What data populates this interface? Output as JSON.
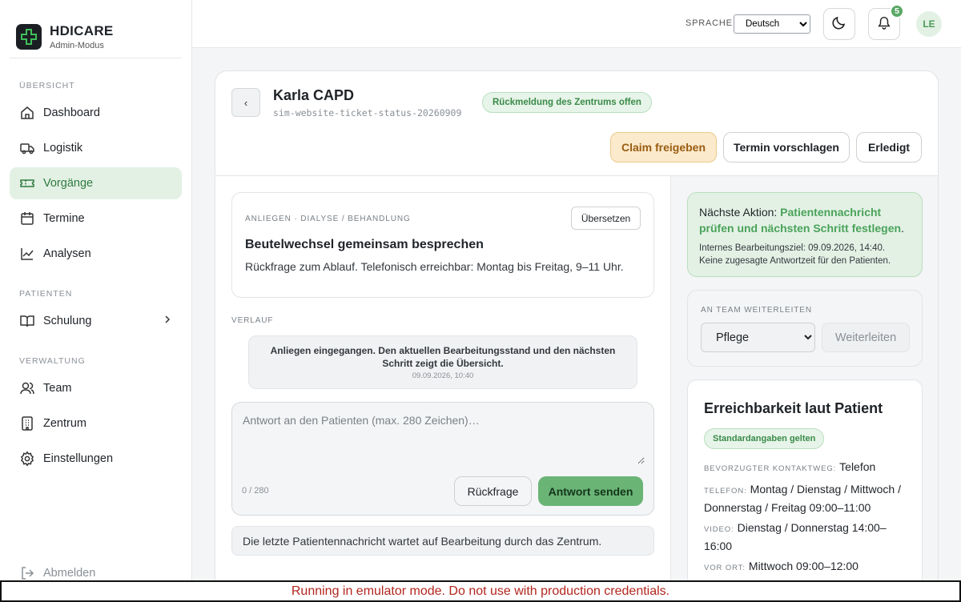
{
  "brand": {
    "name": "HDICARE",
    "subtitle": "Admin-Modus"
  },
  "sidebar": {
    "sections": [
      {
        "title": "ÜBERSICHT"
      },
      {
        "title": "PATIENTEN"
      },
      {
        "title": "VERWALTUNG"
      }
    ],
    "items": {
      "dashboard": "Dashboard",
      "logistik": "Logistik",
      "vorgaenge": "Vorgänge",
      "termine": "Termine",
      "analysen": "Analysen",
      "schulung": "Schulung",
      "team": "Team",
      "zentrum": "Zentrum",
      "einstellungen": "Einstellungen",
      "abmelden": "Abmelden"
    },
    "active": "vorgaenge"
  },
  "topbar": {
    "language_label": "SPRACHE",
    "language_value": "Deutsch",
    "notification_count": "5",
    "avatar_initials": "LE"
  },
  "ticket": {
    "title": "Karla CAPD",
    "id": "sim-website-ticket-status-20260909",
    "status": "Rückmeldung des Zentrums offen",
    "actions": {
      "claim": "Claim freigeben",
      "propose": "Termin vorschlagen",
      "done": "Erledigt"
    }
  },
  "request": {
    "meta": "ANLIEGEN · DIALYSE / BEHANDLUNG",
    "translate": "Übersetzen",
    "title": "Beutelwechsel gemeinsam besprechen",
    "text": "Rückfrage zum Ablauf. Telefonisch erreichbar: Montag bis Freitag, 9–11 Uhr."
  },
  "history": {
    "label": "VERLAUF",
    "events": [
      {
        "text": "Anliegen eingegangen. Den aktuellen Bearbeitungsstand und den nächsten Schritt zeigt die Übersicht.",
        "time": "09.09.2026, 10:40"
      }
    ]
  },
  "reply": {
    "placeholder": "Antwort an den Patienten (max. 280 Zeichen)…",
    "value": "",
    "counter": "0 / 280",
    "ask_label": "Rückfrage",
    "send_label": "Antwort senden"
  },
  "info_bar": "Die letzte Patientennachricht wartet auf Bearbeitung durch das Zentrum.",
  "next_action": {
    "prefix": "Nächste Aktion: ",
    "highlight": "Patientennachricht prüfen und nächsten Schritt festlegen",
    "suffix": ".",
    "target": "Internes Bearbeitungsziel: 09.09.2026, 14:40.",
    "note": "Keine zugesagte Antwortzeit für den Patienten."
  },
  "forward": {
    "label": "AN TEAM WEITERLEITEN",
    "selected": "Pflege",
    "button": "Weiterleiten"
  },
  "reachability": {
    "title": "Erreichbarkeit laut Patient",
    "pill": "Standardangaben gelten",
    "rows": [
      {
        "key": "BEVORZUGTER KONTAKTWEG:",
        "value": "Telefon"
      },
      {
        "key": "TELEFON:",
        "value": "Montag / Dienstag / Mittwoch / Donnerstag / Freitag 09:00–11:00"
      },
      {
        "key": "VIDEO:",
        "value": "Dienstag / Donnerstag 14:00–16:00"
      },
      {
        "key": "VOR ORT:",
        "value": "Mittwoch 09:00–12:00"
      }
    ]
  },
  "emulator_banner": "Running in emulator mode. Do not use with production credentials.",
  "colors": {
    "accent": "#6ab476",
    "accent_light": "#e3f1e5",
    "warning_bg": "#fbeacb",
    "banner_text": "#b3261e"
  }
}
